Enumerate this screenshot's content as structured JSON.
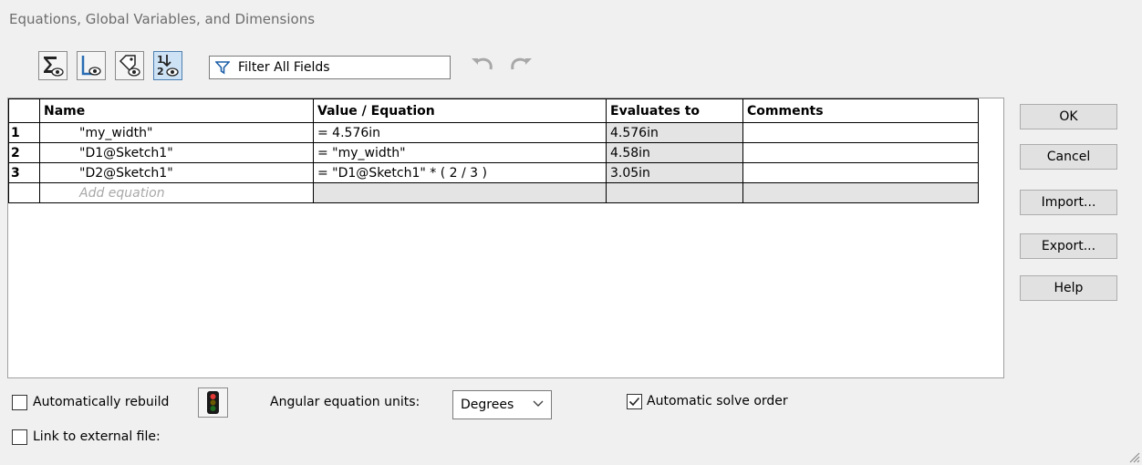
{
  "window": {
    "title": "Equations, Global Variables, and Dimensions"
  },
  "toolbar": {
    "buttons": [
      {
        "icon": "sigma-eye-icon",
        "active": false
      },
      {
        "icon": "sketch-eye-icon",
        "active": false
      },
      {
        "icon": "tag-eye-icon",
        "active": false
      },
      {
        "icon": "order-eye-icon",
        "active": true
      }
    ],
    "filter_text": "Filter All Fields",
    "undo_icon": "undo-icon",
    "redo_icon": "redo-icon"
  },
  "table": {
    "headers": [
      "Name",
      "Value / Equation",
      "Evaluates to",
      "Comments"
    ],
    "rows": [
      {
        "num": "1",
        "name": "\"my_width\"",
        "value": "= 4.576in",
        "evaluates": "4.576in",
        "comments": ""
      },
      {
        "num": "2",
        "name": "\"D1@Sketch1\"",
        "value": "= \"my_width\"",
        "evaluates": "4.58in",
        "comments": ""
      },
      {
        "num": "3",
        "name": "\"D2@Sketch1\"",
        "value": "= \"D1@Sketch1\" * ( 2 / 3 )",
        "evaluates": "3.05in",
        "comments": ""
      }
    ],
    "add_placeholder": "Add equation"
  },
  "buttons": {
    "ok": "OK",
    "cancel": "Cancel",
    "import": "Import...",
    "export": "Export...",
    "help": "Help"
  },
  "options": {
    "auto_rebuild_label": "Automatically rebuild",
    "auto_rebuild_checked": false,
    "angular_units_label": "Angular equation units:",
    "angular_units_value": "Degrees",
    "auto_solve_label": "Automatic solve order",
    "auto_solve_checked": true,
    "link_external_label": "Link to external file:",
    "link_external_checked": false
  },
  "colors": {
    "shaded_cell": "#e4e4e4",
    "placeholder": "#a8a8a8",
    "active_tool": "#cde2f5"
  }
}
